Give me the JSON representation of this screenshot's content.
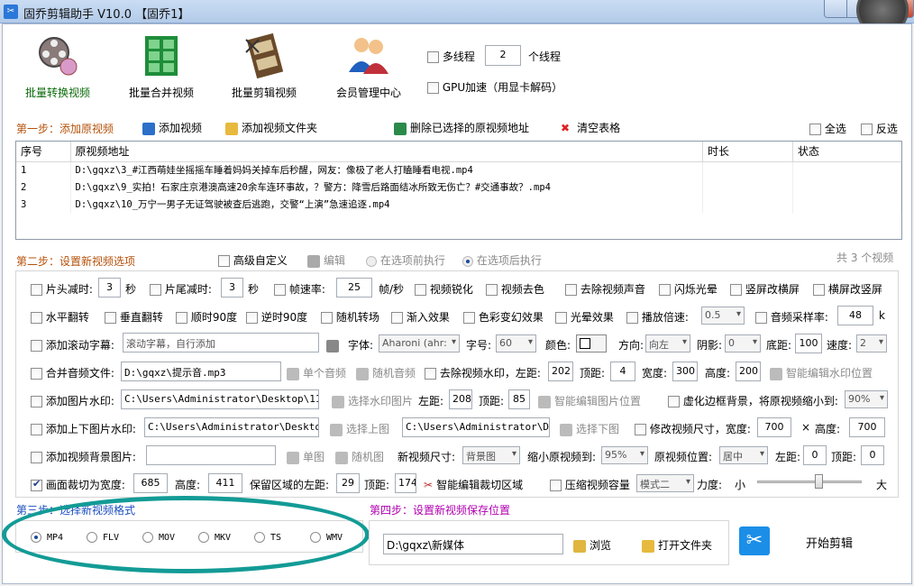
{
  "window": {
    "title": "固乔剪辑助手 V10.0  【固乔1】"
  },
  "toolbar": {
    "items": [
      {
        "label": "批量转换视频",
        "icon": "film-reel-icon"
      },
      {
        "label": "批量合并视频",
        "icon": "film-grid-icon"
      },
      {
        "label": "批量剪辑视频",
        "icon": "film-strip-icon"
      },
      {
        "label": "会员管理中心",
        "icon": "members-icon"
      }
    ],
    "multithread_label": "多线程",
    "thread_count": "2",
    "thread_unit": "个线程",
    "gpu_label": "GPU加速（用显卡解码）"
  },
  "step1": {
    "title": "第一步：添加原视频",
    "add_video": "添加视频",
    "add_folder": "添加视频文件夹",
    "delete_selected": "删除已选择的原视频地址",
    "clear_table": "清空表格",
    "select_all": "全选",
    "invert_select": "反选"
  },
  "table": {
    "headers": [
      "序号",
      "原视频地址",
      "时长",
      "状态"
    ],
    "rows": [
      {
        "num": "1",
        "path": "D:\\gqxz\\3_#江西萌娃坐摇摇车睡着妈妈关掉车后秒醒，网友：像极了老人打瞌睡看电视.mp4"
      },
      {
        "num": "2",
        "path": "D:\\gqxz\\9_实拍！石家庄京港澳高速20余车连环事故，？警方：降雪后路面结冰所致无伤亡？#交通事故？.mp4"
      },
      {
        "num": "3",
        "path": "D:\\gqxz\\10_万宁一男子无证驾驶被查后逃跑，交警“上演”急速追逐.mp4"
      }
    ],
    "count_text": "共 3 个视频"
  },
  "step2": {
    "title": "第二步：设置新视频选项",
    "advanced": "高级自定义",
    "edit": "编辑",
    "before": "在选项前执行",
    "after": "在选项后执行",
    "row1": {
      "head_cut": "片头减时:",
      "head_val": "3",
      "sec1": "秒",
      "tail_cut": "片尾减时:",
      "tail_val": "3",
      "sec2": "秒",
      "fps": "帧速率:",
      "fps_val": "25",
      "fps_unit": "帧/秒",
      "sharpen": "视频锐化",
      "decolor": "视频去色",
      "mute": "去除视频声音",
      "flash": "闪烁光晕",
      "v2h": "竖屏改横屏",
      "h2v": "横屏改竖屏"
    },
    "row2": {
      "hflip": "水平翻转",
      "vflip": "垂直翻转",
      "cw90": "顺时90度",
      "ccw90": "逆时90度",
      "random_trans": "随机转场",
      "fade_in": "渐入效果",
      "color": "色彩变幻效果",
      "halo": "光晕效果",
      "speed": "播放倍速:",
      "speed_val": "0.5",
      "audio_rate": "音频采样率:",
      "audio_val": "48",
      "audio_unit": "k"
    },
    "row3": {
      "scroll": "添加滚动字幕:",
      "scroll_placeholder": "滚动字幕，自行添加",
      "font": "字体:",
      "font_val": "Aharoni (ahr:",
      "size": "字号:",
      "size_val": "60",
      "color": "颜色:",
      "dir": "方向:",
      "dir_val": "向左",
      "shadow": "阴影:",
      "shadow_val": "0",
      "bottom": "底距:",
      "bottom_val": "100",
      "speed": "速度:",
      "speed_val": "2"
    },
    "row4": {
      "merge_audio": "合并音频文件:",
      "audio_path": "D:\\gqxz\\提示音.mp3",
      "single_audio": "单个音频",
      "random_audio": "随机音频",
      "remove_wm": "去除视频水印，左距:",
      "left_val": "202",
      "top": "顶距:",
      "top_val": "4",
      "width": "宽度:",
      "width_val": "300",
      "height": "高度:",
      "height_val": "200",
      "smart_wm": "智能编辑水印位置"
    },
    "row5": {
      "img_wm": "添加图片水印:",
      "img_path": "C:\\Users\\Administrator\\Desktop\\111.j",
      "choose_img": "选择水印图片",
      "left": "左距:",
      "left_val": "208",
      "top": "顶距:",
      "top_val": "85",
      "smart_img": "智能编辑图片位置",
      "blur_bg": "虚化边框背景，将原视频缩小到:",
      "blur_val": "90%"
    },
    "row6": {
      "top_bottom_wm": "添加上下图片水印:",
      "top_path": "C:\\Users\\Administrator\\Desktop\\i",
      "choose_top": "选择上图",
      "bottom_path": "C:\\Users\\Administrator\\Desk",
      "choose_bottom": "选择下图",
      "resize": "修改视频尺寸，宽度:",
      "w_val": "700",
      "times": "×",
      "h_label": "高度:",
      "h_val": "700"
    },
    "row7": {
      "bg_img": "添加视频背景图片:",
      "single": "单图",
      "random": "随机图",
      "new_size": "新视频尺寸:",
      "new_size_val": "背景图",
      "shrink": "缩小原视频到:",
      "shrink_val": "95%",
      "pos": "原视频位置:",
      "pos_val": "居中",
      "left": "左距:",
      "left_val": "0",
      "top": "顶距:",
      "top_val": "0"
    },
    "row8": {
      "crop": "画面裁切为宽度:",
      "crop_w": "685",
      "h": "高度:",
      "crop_h": "411",
      "keep_left": "保留区域的左距:",
      "left_val": "29",
      "top": "顶距:",
      "top_val": "174",
      "smart_crop": "智能编辑裁切区域",
      "compress": "压缩视频容量",
      "mode_val": "模式二",
      "strength": "力度:",
      "small": "小",
      "big": "大",
      "strength_level": 0.6
    }
  },
  "step3": {
    "title": "第三步：选择新视频格式",
    "formats": [
      "MP4",
      "FLV",
      "MOV",
      "MKV",
      "TS",
      "WMV"
    ],
    "selected": "MP4"
  },
  "step4": {
    "title": "第四步：设置新视频保存位置",
    "path": "D:\\gqxz\\新媒体",
    "browse": "浏览",
    "open_folder": "打开文件夹",
    "start": "开始剪辑"
  },
  "colors": {
    "step_title": "#b5510a",
    "step3_title": "#1a4fbf",
    "step4_title": "#b000b0",
    "highlight_ellipse": "#139b96"
  }
}
